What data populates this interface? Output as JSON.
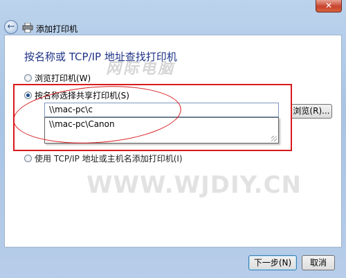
{
  "window": {
    "title": "添加打印机",
    "close_label": "✕"
  },
  "page": {
    "heading": "按名称或 TCP/IP 地址查找打印机"
  },
  "options": {
    "browse_label": "浏览打印机(W)",
    "by_name_label": "按名称选择共享打印机(S)",
    "tcpip_label": "使用 TCP/IP 地址或主机名添加打印机(I)",
    "selected": "by_name"
  },
  "share_input": {
    "value": "\\\\mac-pc\\c"
  },
  "suggestions": [
    "\\\\mac-pc\\Canon"
  ],
  "browse_button": "浏览(R)...",
  "footer": {
    "next_label": "下一步(N)",
    "cancel_label": "取消"
  },
  "watermarks": {
    "top": "网际电脑",
    "center": "WWW.WJDIY.CN"
  },
  "annotation": {
    "color": "#d8181b"
  }
}
